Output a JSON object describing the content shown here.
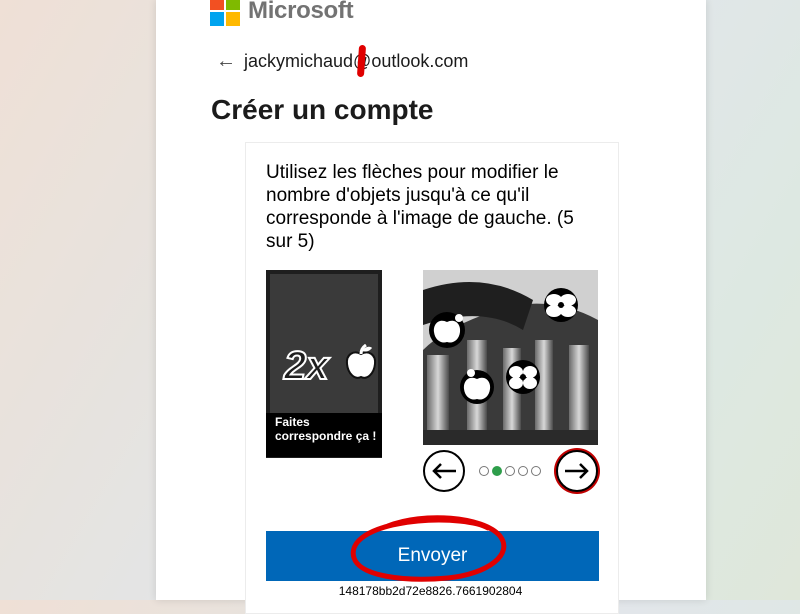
{
  "brand": {
    "name": "Microsoft",
    "logo_colors": [
      "#f25022",
      "#7fba00",
      "#00a4ef",
      "#ffb900"
    ]
  },
  "account": {
    "back_icon": "arrow-left-icon",
    "email": "jackymichaud",
    "email_domain": "@outlook.com"
  },
  "page_title": "Créer un compte",
  "puzzle": {
    "instructions": "Utilisez les flèches pour modifier le nombre d'objets jusqu'à ce qu'il corresponde à l'image de gauche. (5 sur 5)",
    "reference_count": "2x",
    "reference_icon": "apple-icon",
    "reference_caption": "Faites correspondre ça !",
    "prev_icon": "arrow-left-icon",
    "next_icon": "arrow-right-icon",
    "dots_total": 5,
    "dot_active": 2
  },
  "submit_label": "Envoyer",
  "session_id": "148178bb2d72e8826.7661902804",
  "colors": {
    "accent": "#0067b8",
    "annotation": "#e00000",
    "active_dot": "#2e9e4b"
  }
}
